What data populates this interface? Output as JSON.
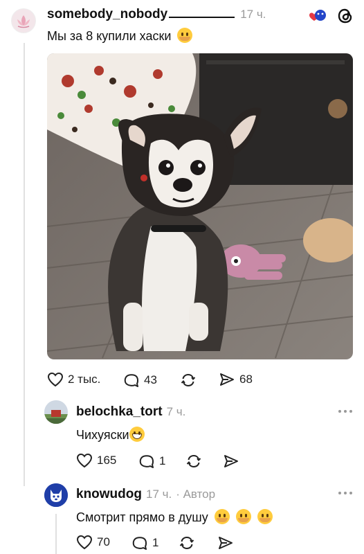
{
  "post": {
    "username": "somebody_nobody",
    "time": "17 ч.",
    "text": "Мы за 8 купили хаски",
    "likes": "2 тыс.",
    "comments": "43",
    "shares": "68"
  },
  "replies": [
    {
      "username": "belochka_tort",
      "time": "7 ч.",
      "author_tag": "",
      "text": "Чихуяски",
      "likes": "165",
      "comments": "1"
    },
    {
      "username": "knowudog",
      "time": "17 ч.",
      "author_tag": "· Автор",
      "text": "Смотрит прямо в душу",
      "likes": "70",
      "comments": "1"
    }
  ],
  "icons": {
    "like": "heart-icon",
    "comment": "comment-icon",
    "repost": "repost-icon",
    "share": "send-icon",
    "app": "threads-logo-icon",
    "more": "more-icon"
  },
  "colors": {
    "muted": "#9a9a9a",
    "text": "#111111",
    "thread_line": "#e0e0e0"
  }
}
